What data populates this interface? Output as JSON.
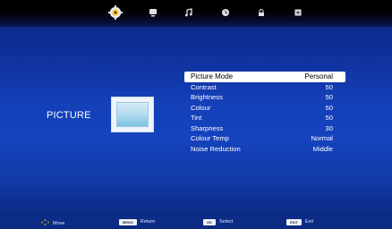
{
  "top_icons": [
    "picture-gear-icon",
    "tv-icon",
    "music-note-icon",
    "clock-icon",
    "lock-icon",
    "settings-square-icon"
  ],
  "section_title": "PICTURE",
  "menu_items": [
    {
      "label": "Picture Mode",
      "value": "Personal"
    },
    {
      "label": "Contrast",
      "value": "50"
    },
    {
      "label": "Brightness",
      "value": "50"
    },
    {
      "label": "Colour",
      "value": "50"
    },
    {
      "label": "Tint",
      "value": "50"
    },
    {
      "label": "Sharpness",
      "value": "30"
    },
    {
      "label": "Colour Temp",
      "value": "Normal"
    },
    {
      "label": "Noise Reduction",
      "value": "Middle"
    }
  ],
  "bottom_hints": {
    "move": {
      "label": "Move"
    },
    "menu": {
      "key": "MENU",
      "label": "Return"
    },
    "ok": {
      "key": "OK",
      "label": "Select"
    },
    "exit": {
      "key": "EXIT",
      "label": "Exit"
    }
  },
  "colors": {
    "background": "#1440b8",
    "highlight": "#ffffff",
    "accent_icon": "#f5c400"
  }
}
